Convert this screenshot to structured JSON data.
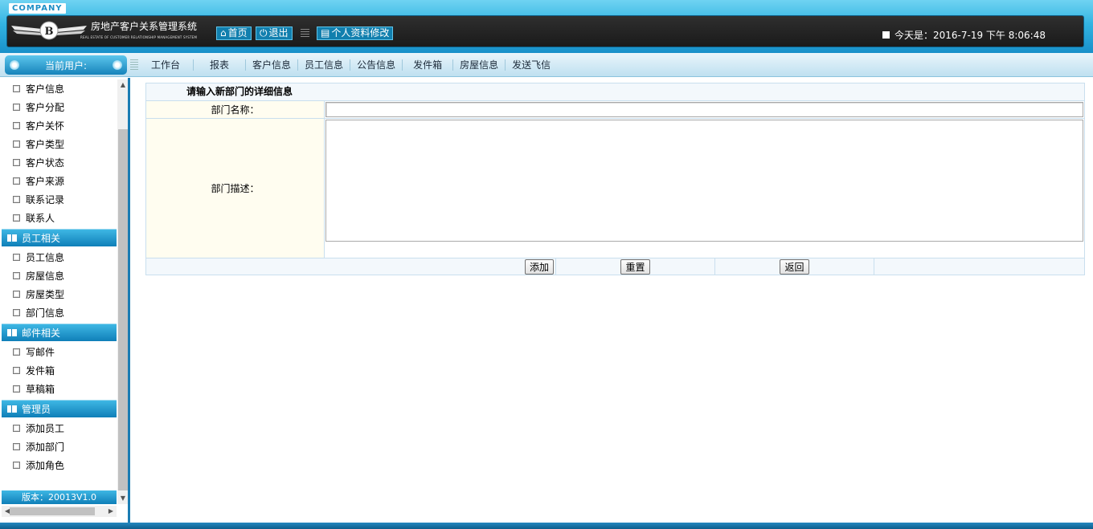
{
  "header": {
    "company": "COMPANY",
    "title": "房地产客户关系管理系统",
    "subtitle": "REAL ESTATE OF CUSTOMER RELATIONSHIP MANAGEMENT SYSTEM",
    "home_label": "首页",
    "logout_label": "退出",
    "profile_label": "个人资料修改",
    "today_label": "今天是：2016-7-19 下午 8:06:48"
  },
  "nav": {
    "current_user_label": "当前用户:",
    "items": [
      "工作台",
      "报表",
      "客户信息",
      "员工信息",
      "公告信息",
      "发件箱",
      "房屋信息",
      "发送飞信"
    ]
  },
  "sidebar": {
    "customer_items": [
      "客户信息",
      "客户分配",
      "客户关怀",
      "客户类型",
      "客户状态",
      "客户来源",
      "联系记录",
      "联系人"
    ],
    "staff_title": "员工相关",
    "staff_items": [
      "员工信息",
      "房屋信息",
      "房屋类型",
      "部门信息"
    ],
    "mail_title": "邮件相关",
    "mail_items": [
      "写邮件",
      "发件箱",
      "草稿箱"
    ],
    "admin_title": "管理员",
    "admin_items": [
      "添加员工",
      "添加部门",
      "添加角色"
    ],
    "version": "版本：20013V1.0"
  },
  "form": {
    "title": "请输入新部门的详细信息",
    "name_label": "部门名称：",
    "name_value": "",
    "desc_label": "部门描述：",
    "desc_value": "",
    "add_label": "添加",
    "reset_label": "重置",
    "back_label": "返回"
  },
  "colors": {
    "header_blue": "#33b4e2",
    "header_dark": "#1a1a1a",
    "sidebar_head": "#1a82bb",
    "label_bg": "#fffdf0"
  }
}
